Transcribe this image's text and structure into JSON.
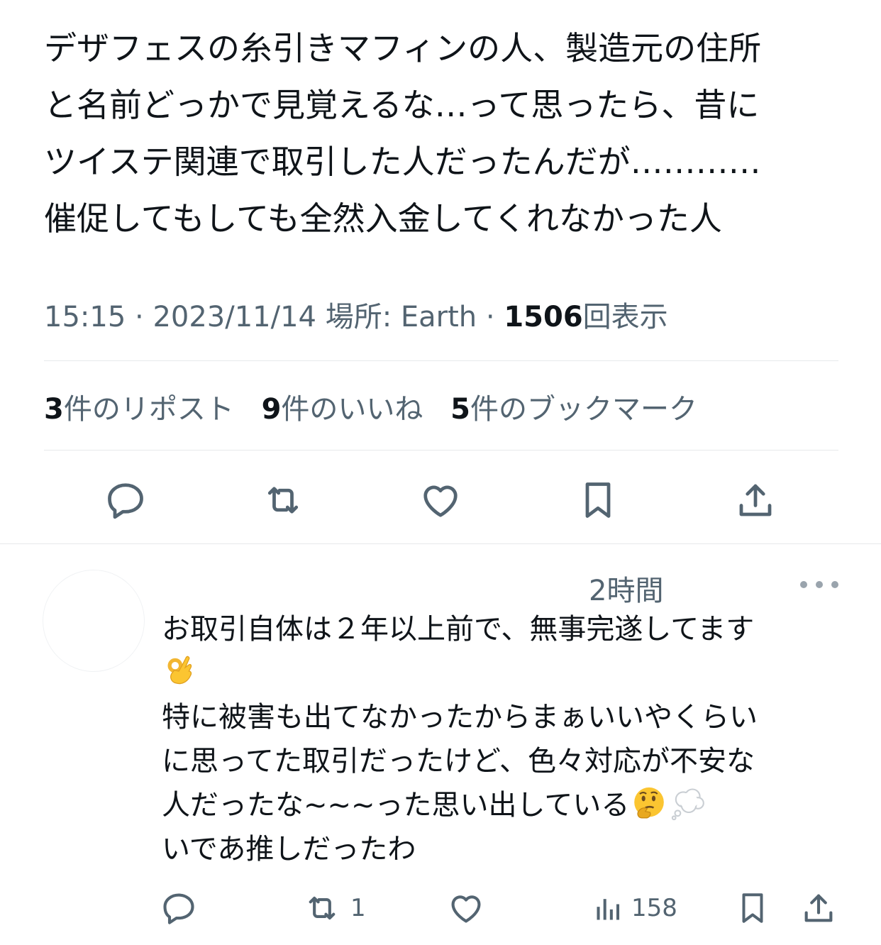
{
  "tweet": {
    "text": "デザフェスの糸引きマフィンの人、製造元の住所\nと名前どっかで見覚えるな…って思ったら、昔に\nツイステ関連で取引した人だったんだが…………\n催促してもしても全然入金してくれなかった人",
    "time": "15:15",
    "date": "2023/11/14",
    "location_label": "場所: Earth",
    "views_count": "1506",
    "views_label": "回表示",
    "stats": {
      "reposts_count": "3",
      "reposts_label": "件のリポスト",
      "likes_count": "9",
      "likes_label": "件のいいね",
      "bookmarks_count": "5",
      "bookmarks_label": "件のブックマーク"
    },
    "action_icons": [
      "reply-icon",
      "repost-icon",
      "like-icon",
      "bookmark-icon",
      "share-icon"
    ]
  },
  "reply": {
    "time": "2時間",
    "lines": [
      "お取引自体は２年以上前で、無事完遂してます",
      "",
      "特に被害も出てなかったからまぁいいやくらい",
      "に思ってた取引だったけど、色々対応が不安な",
      "人だったな~~~った思い出している",
      "いであ推しだったわ"
    ],
    "emojis": [
      "ok-hand-emoji",
      "thinking-face-emoji",
      "thought-balloon-emoji"
    ],
    "retweet_count": "1",
    "views_count": "158"
  },
  "colors": {
    "text": "#0f1419",
    "secondary": "#536471",
    "icon": "#536471",
    "divider": "#e7e9eb"
  }
}
